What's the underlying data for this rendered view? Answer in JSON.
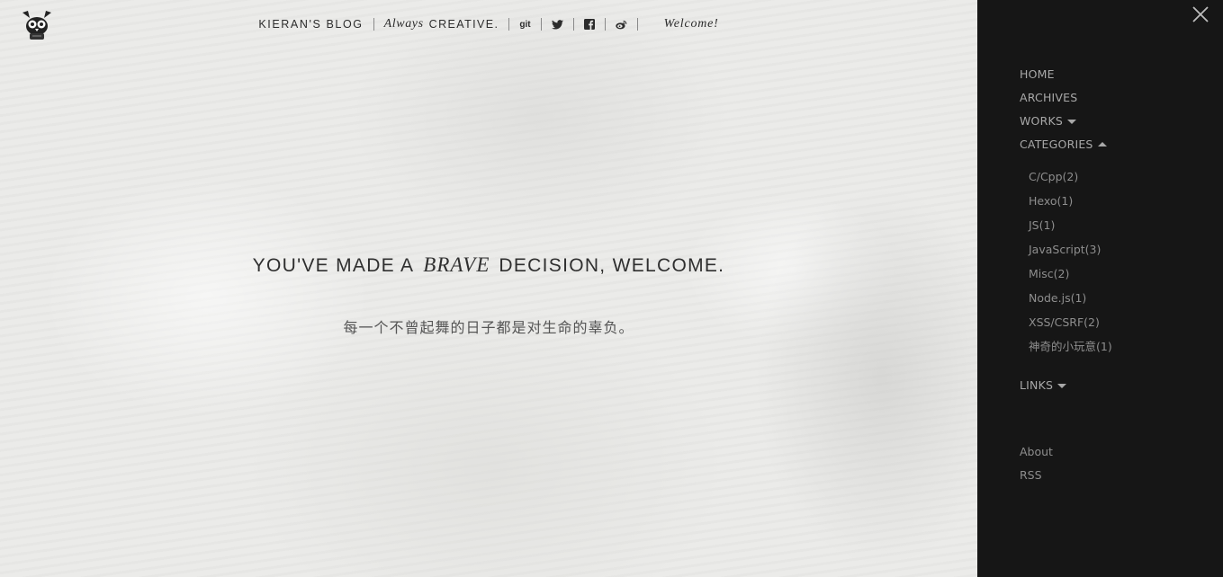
{
  "header": {
    "logo": "owl-robot-logo",
    "brand": "KIERAN'S BLOG",
    "tagline_italic": "Always",
    "tagline_caps": "CREATIVE.",
    "git_label": "git",
    "icons": [
      "twitter-icon",
      "facebook-icon",
      "weibo-icon"
    ],
    "welcome": "Welcome!"
  },
  "hero": {
    "headline_pre": "YOU'VE MADE A",
    "headline_em": "BRAVE",
    "headline_post": "DECISION, WELCOME.",
    "subline": "每一个不曾起舞的日子都是对生命的辜负。"
  },
  "sidebar": {
    "close_icon": "close-icon",
    "menu": [
      {
        "label": "HOME"
      },
      {
        "label": "ARCHIVES"
      },
      {
        "label": "WORKS",
        "caret": "down"
      },
      {
        "label": "CATEGORIES",
        "caret": "up"
      }
    ],
    "categories": [
      "C/Cpp(2)",
      "Hexo(1)",
      "JS(1)",
      "JavaScript(3)",
      "Misc(2)",
      "Node.js(1)",
      "XSS/CSRF(2)",
      "神奇的小玩意(1)"
    ],
    "links_label": "LINKS",
    "bottom": [
      "About",
      "RSS"
    ],
    "colors": {
      "background": "#161616",
      "text": "#a8a8a8"
    }
  }
}
